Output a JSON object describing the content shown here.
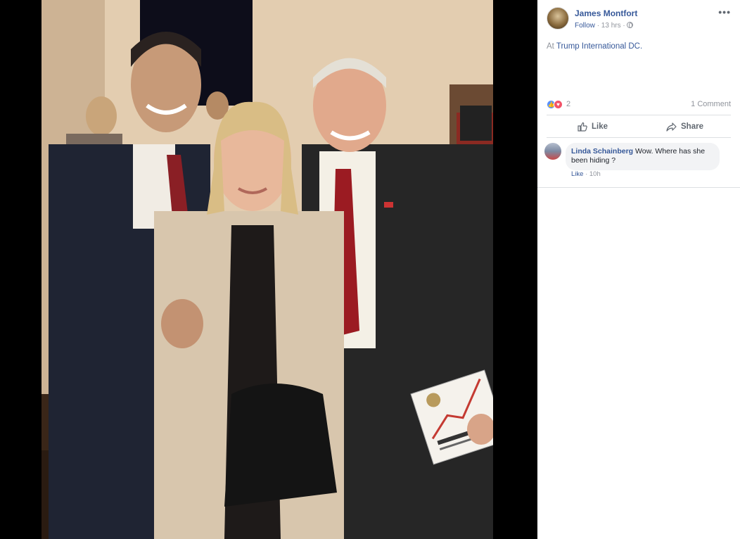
{
  "post": {
    "author": "James Montfort",
    "follow_label": "Follow",
    "time": "13 hrs",
    "caption_prefix": "At",
    "caption_place": "Trump International DC.",
    "reactions_count": "2",
    "comments_count": "1 Comment",
    "like_label": "Like",
    "share_label": "Share"
  },
  "comments": [
    {
      "name": "Linda Schainberg",
      "text": "Wow. Where has she been hiding ?",
      "like_label": "Like",
      "time": "10h"
    }
  ],
  "icons": {
    "more": "more-options-icon",
    "privacy": "globe-icon",
    "like_reaction": "like-reaction-icon",
    "love_reaction": "love-reaction-icon",
    "like_action": "thumbs-up-icon",
    "share_action": "share-arrow-icon"
  },
  "colors": {
    "link": "#365899",
    "muted": "#90949c",
    "like_blue": "#5890ff",
    "love_red": "#f25268"
  }
}
